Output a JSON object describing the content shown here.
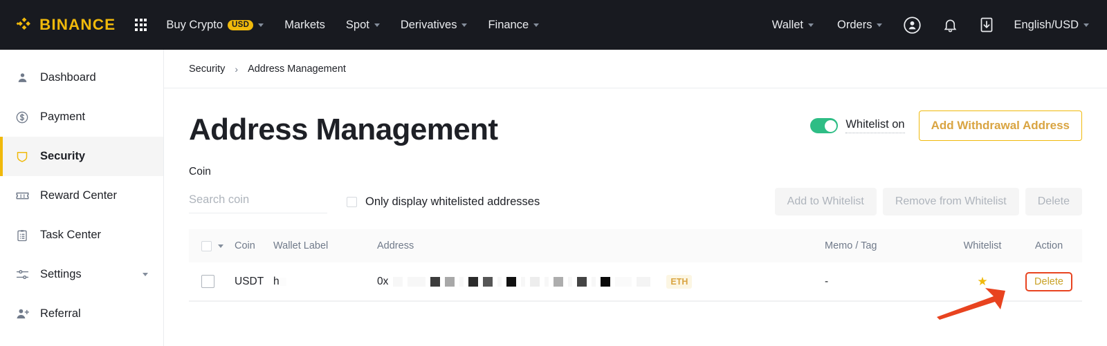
{
  "topnav": {
    "brand": "BINANCE",
    "apps_icon": "grid-apps-icon",
    "items": [
      {
        "label": "Buy Crypto",
        "badge": "USD",
        "caret": true
      },
      {
        "label": "Markets",
        "caret": false
      },
      {
        "label": "Spot",
        "caret": true
      },
      {
        "label": "Derivatives",
        "caret": true
      },
      {
        "label": "Finance",
        "caret": true
      }
    ],
    "right_items": [
      {
        "label": "Wallet",
        "caret": true
      },
      {
        "label": "Orders",
        "caret": true
      }
    ],
    "icons": [
      "user-circle-icon",
      "bell-icon",
      "download-icon"
    ],
    "language": "English/USD"
  },
  "sidebar": {
    "items": [
      {
        "label": "Dashboard",
        "icon": "user-icon",
        "active": false,
        "caret": false
      },
      {
        "label": "Payment",
        "icon": "dollar-circle-icon",
        "active": false,
        "caret": false
      },
      {
        "label": "Security",
        "icon": "shield-icon",
        "active": true,
        "caret": false
      },
      {
        "label": "Reward Center",
        "icon": "ticket-icon",
        "active": false,
        "caret": false
      },
      {
        "label": "Task Center",
        "icon": "clipboard-icon",
        "active": false,
        "caret": false
      },
      {
        "label": "Settings",
        "icon": "sliders-icon",
        "active": false,
        "caret": true
      },
      {
        "label": "Referral",
        "icon": "user-plus-icon",
        "active": false,
        "caret": false
      }
    ]
  },
  "breadcrumb": {
    "parent": "Security",
    "separator": "›",
    "current": "Address Management"
  },
  "page": {
    "title": "Address Management",
    "whitelist_toggle": {
      "label": "Whitelist on",
      "state": "on"
    },
    "add_address_button": "Add Withdrawal Address"
  },
  "filters": {
    "coin_label": "Coin",
    "search_placeholder": "Search coin",
    "search_value": "",
    "only_whitelisted_label": "Only display whitelisted addresses",
    "only_whitelisted_checked": false,
    "buttons": [
      {
        "label": "Add to Whitelist",
        "disabled": true
      },
      {
        "label": "Remove from Whitelist",
        "disabled": true
      },
      {
        "label": "Delete",
        "disabled": true
      }
    ]
  },
  "table": {
    "headers": {
      "coin": "Coin",
      "wallet_label": "Wallet Label",
      "address": "Address",
      "memo_tag": "Memo / Tag",
      "whitelist": "Whitelist",
      "action": "Action"
    },
    "rows": [
      {
        "selected": false,
        "coin": "USDT",
        "wallet_label": "h",
        "address_prefix": "0x",
        "address_redacted": true,
        "network_badge": "ETH",
        "memo_tag": "-",
        "whitelisted": true,
        "action_label": "Delete"
      }
    ]
  },
  "annotation": {
    "type": "arrow-and-box",
    "target": "delete-link",
    "color": "#E8431F"
  },
  "colors": {
    "brand_yellow": "#F0B90B",
    "nav_dark": "#181A20",
    "toggle_green": "#2EBD85",
    "annotation_red": "#E8431F",
    "badge_gold": "#D9A441"
  },
  "redaction_blocks": {
    "address": [
      "#F7F7F7",
      "#3C3C3C",
      "#A8A8A8",
      "#2B2B2B",
      "#565656",
      "#111111",
      "#EDEDED",
      "#ADADAD",
      "#444444",
      "#0A0A0A",
      "#FAFAFA",
      "#F4F4F4"
    ],
    "wallet_label": [
      "#FCFCFC",
      "#F8F8F8"
    ],
    "memo_left": [
      "#F6F6F6"
    ]
  }
}
